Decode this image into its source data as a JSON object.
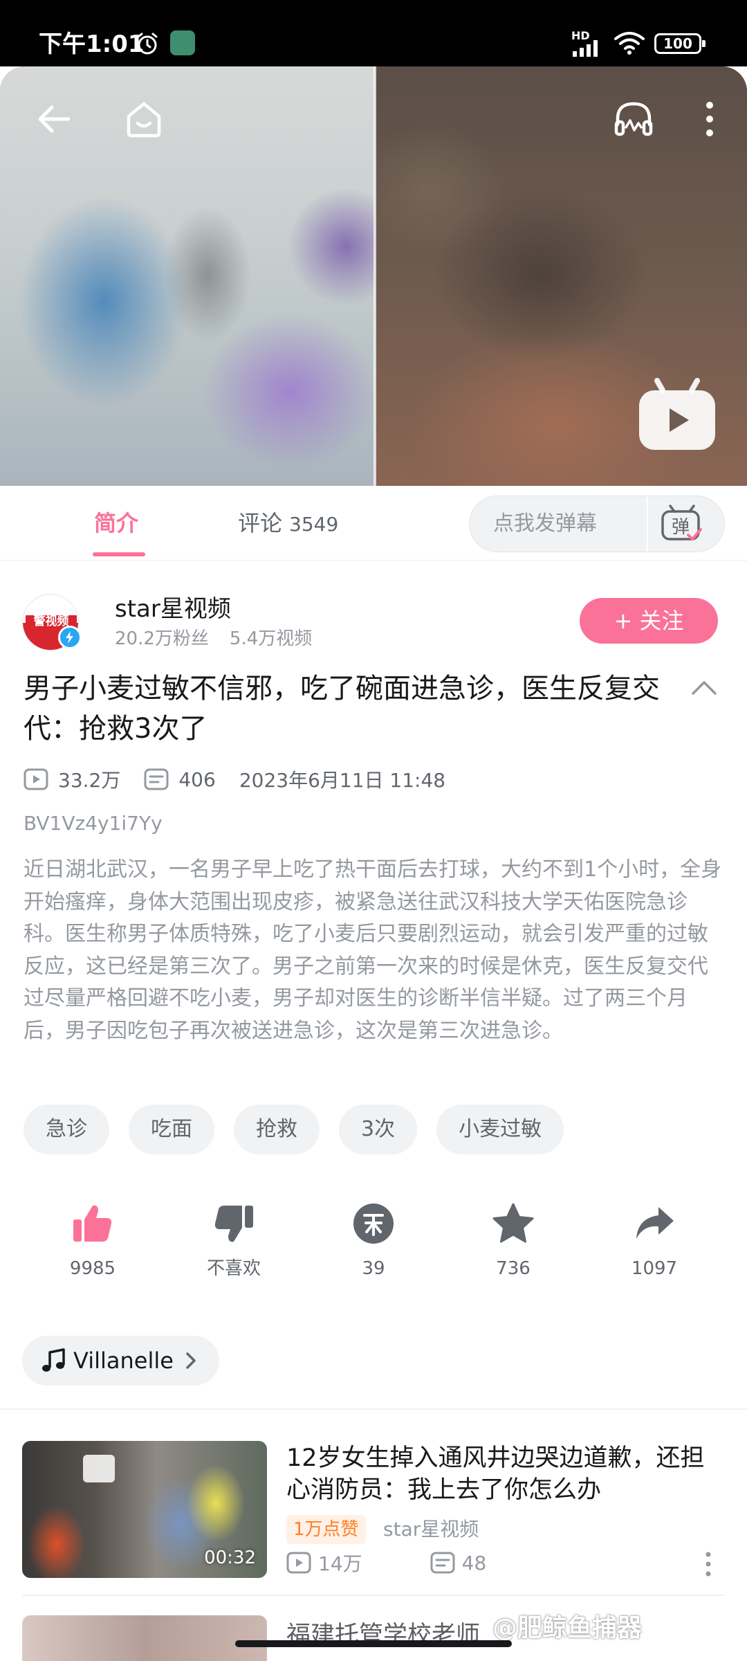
{
  "status_bar": {
    "time": "下午1:01",
    "network": "HD",
    "battery": "100"
  },
  "player": {
    "icons": [
      "back-arrow-icon",
      "home-icon",
      "headphones-icon",
      "more-vertical-icon",
      "tv-play-icon"
    ]
  },
  "tabs": {
    "intro_label": "简介",
    "comments_label": "评论",
    "comments_count": "3549",
    "danmaku_placeholder": "点我发弹幕",
    "danmaku_toggle_label": "弹",
    "accent_color": "#fb7299"
  },
  "uploader": {
    "avatar_text": "警视频",
    "name": "star星视频",
    "fans": "20.2万粉丝",
    "videos": "5.4万视频",
    "follow_label": "+ 关注"
  },
  "video": {
    "title": "男子小麦过敏不信邪，吃了碗面进急诊，医生反复交代：抢救3次了",
    "views": "33.2万",
    "danmaku_count": "406",
    "date": "2023年6月11日 11:48",
    "bvid": "BV1Vz4y1i7Yy",
    "description": "近日湖北武汉，一名男子早上吃了热干面后去打球，大约不到1个小时，全身开始瘙痒，身体大范围出现皮疹，被紧急送往武汉科技大学天佑医院急诊科。医生称男子体质特殊，吃了小麦后只要剧烈运动，就会引发严重的过敏反应，这已经是第三次了。男子之前第一次来的时候是休克，医生反复交代过尽量严格回避不吃小麦，男子却对医生的诊断半信半疑。过了两三个月后，男子因吃包子再次被送进急诊，这次是第三次进急诊。"
  },
  "tags": [
    "急诊",
    "吃面",
    "抢救",
    "3次",
    "小麦过敏"
  ],
  "actions": {
    "like": "9985",
    "dislike": "不喜欢",
    "coin": "39",
    "favorite": "736",
    "share": "1097"
  },
  "music": {
    "title": "Villanelle"
  },
  "recommended": [
    {
      "title": "12岁女生掉入通风井边哭边道歉，还担心消防员：我上去了你怎么办",
      "duration": "00:32",
      "badge": "1万点赞",
      "author": "star星视频",
      "views": "14万",
      "danmaku": "48"
    }
  ],
  "next_preview": {
    "title_fragment": "福建托管学校老师"
  },
  "watermark": "@肥鲸鱼捕器"
}
